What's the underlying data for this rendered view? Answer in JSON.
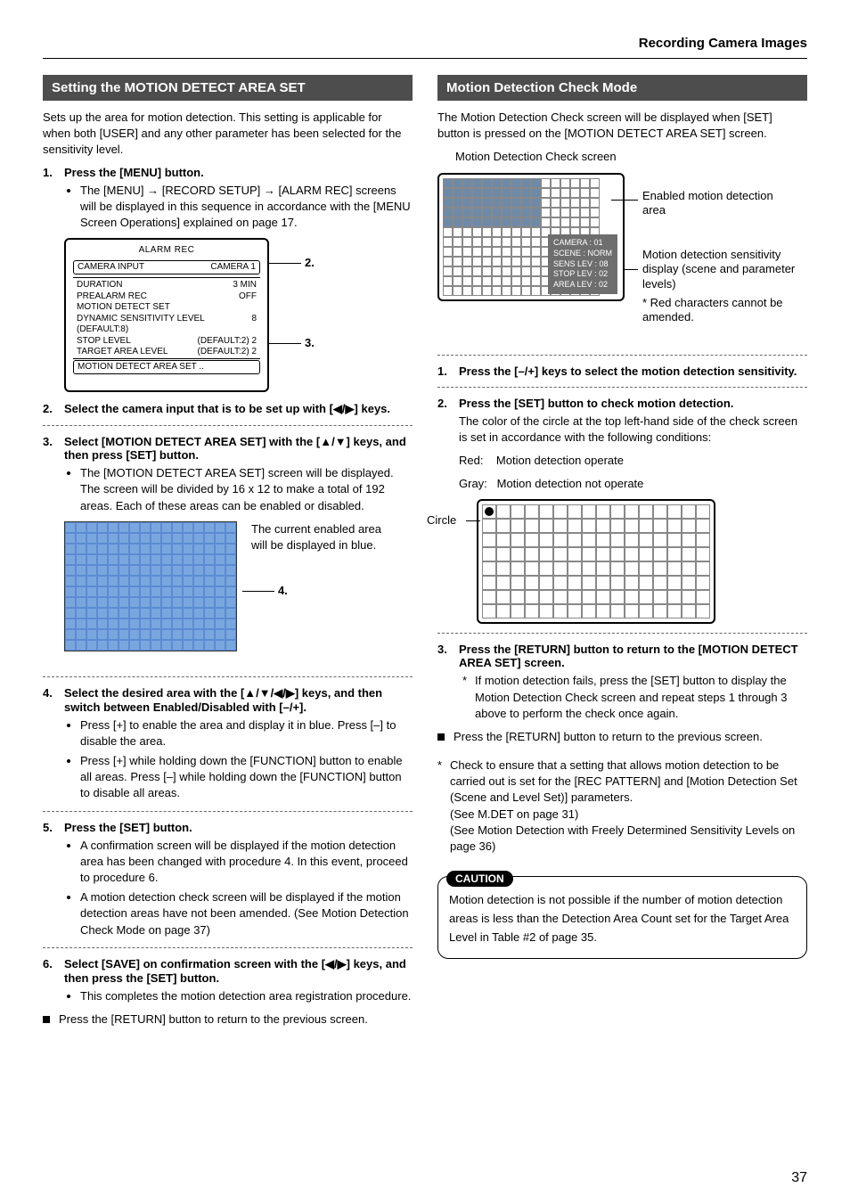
{
  "header": {
    "section": "Recording Camera Images"
  },
  "left": {
    "title": "Setting the MOTION DETECT AREA SET",
    "intro": "Sets up the area for motion detection. This setting is applicable for when both [USER] and any other parameter has been selected for the sensitivity level.",
    "step1": {
      "head": "Press the [MENU] button.",
      "b1": "The [MENU] → [RECORD SETUP] → [ALARM REC] screens will be displayed in this sequence in accordance with the [MENU Screen Operations] explained on page 17."
    },
    "alarm": {
      "title": "ALARM REC",
      "row1L": "CAMERA INPUT",
      "row1R": "CAMERA 1",
      "r2L": "DURATION",
      "r2R": "3 MIN",
      "r3L": "PREALARM REC",
      "r3R": "OFF",
      "r4L": "MOTION DETECT SET",
      "r4R": "",
      "r5L": "DYNAMIC SENSITIVITY LEVEL (DEFAULT:8)",
      "r5R": "8",
      "r6L": "STOP LEVEL",
      "r6M": "(DEFAULT:2)",
      "r6R": "2",
      "r7L": "TARGET AREA LEVEL",
      "r7M": "(DEFAULT:2)",
      "r7R": "2",
      "r8L": "MOTION DETECT AREA SET ..",
      "call2": "2.",
      "call3": "3."
    },
    "step2": {
      "head": "Select the camera input that is to be set up with [◀/▶] keys."
    },
    "step3": {
      "head": "Select [MOTION DETECT AREA SET] with the [▲/▼] keys, and then press [SET] button.",
      "b1": "The [MOTION DETECT AREA SET] screen will be displayed. The screen will be divided by 16 x 12 to make a total of 192 areas. Each of these areas can be enabled or disabled."
    },
    "grid_note": "The current enabled area will be displayed in blue.",
    "grid_call4": "4.",
    "step4": {
      "head": "Select the desired area with the [▲/▼/◀/▶] keys, and then switch between Enabled/Disabled with [–/+].",
      "b1": "Press [+] to enable the area and display it in blue. Press [–] to disable the area.",
      "b2": "Press [+] while holding down the [FUNCTION] button to enable all areas. Press [–] while holding down the [FUNCTION] button to disable all areas."
    },
    "step5": {
      "head": "Press the [SET] button.",
      "b1": "A confirmation screen will be displayed if the motion detection area has been changed with procedure 4. In this event, proceed to procedure 6.",
      "b2": "A motion detection check screen will be displayed if the motion detection areas have not been amended. (See Motion Detection Check Mode on page 37)"
    },
    "step6": {
      "head": "Select [SAVE] on confirmation screen with the [◀/▶] keys, and then press the [SET] button.",
      "b1": "This completes the motion detection area registration procedure."
    },
    "final_sq": "Press the [RETURN] button to return to the previous screen."
  },
  "right": {
    "title": "Motion Detection Check Mode",
    "intro": "The Motion Detection Check screen will be displayed when [SET] button is pressed on the [MOTION DETECT AREA SET] screen.",
    "fig_caption": "Motion Detection Check screen",
    "overlay": {
      "l1": "CAMERA :  01",
      "l2": "SCENE    : NORM",
      "l3": "SENS LEV : 08",
      "l4": "STOP LEV : 02",
      "l5": "AREA LEV : 02"
    },
    "lbl_enabled": "Enabled motion detection area",
    "lbl_sens": "Motion detection sensitivity display (scene and parameter levels)",
    "lbl_star": "* Red characters cannot be amended.",
    "step1": {
      "head": "Press the [–/+] keys to select the motion detection sensitivity."
    },
    "step2": {
      "head": "Press the [SET] button to check motion detection.",
      "p1": "The color of the circle at the top left-hand side of the check screen is set in accordance with the following conditions:",
      "red": "Red:    Motion detection operate",
      "gray": "Gray:   Motion detection not operate"
    },
    "circle_lbl": "Circle",
    "step3": {
      "head": "Press the [RETURN] button to return to the [MOTION DETECT AREA SET] screen.",
      "star": "If motion detection fails, press the [SET] button to display the Motion Detection Check screen and repeat steps 1 through 3 above to perform the check once again."
    },
    "sq_return": "Press the [RETURN] button to return to the previous screen.",
    "star_check": "Check to ensure that a setting that allows motion detection to be carried out is set for the [REC PATTERN] and [Motion Detection Set (Scene and Level Set)] parameters.\n(See M.DET on page 31)\n(See Motion Detection with Freely Determined Sensitivity Levels on page 36)",
    "caution_label": "CAUTION",
    "caution_text": "Motion detection is not possible if the number of motion detection areas is less than the Detection Area Count set for the Target Area Level in Table #2 of page 35."
  },
  "page_number": "37"
}
